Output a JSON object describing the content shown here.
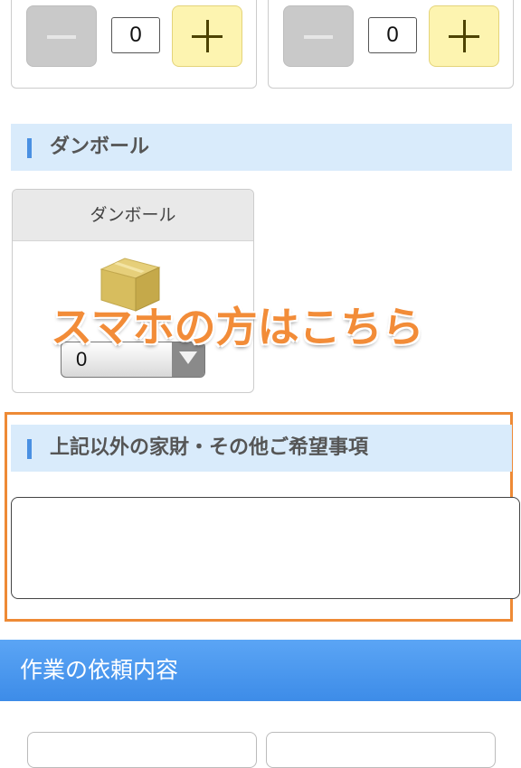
{
  "top_steppers": [
    {
      "value": "0"
    },
    {
      "value": "0"
    }
  ],
  "sections": {
    "cardboard": {
      "title": "ダンボール",
      "card_title": "ダンボール",
      "select_value": "0",
      "icon": "cardboard-box-icon"
    },
    "notes": {
      "title": "上記以外の家財・その他ご希望事項",
      "textarea_value": ""
    }
  },
  "overlay": {
    "text": "スマホの方はこちら",
    "color": "#f28c38"
  },
  "work_section": {
    "title": "作業の依頼内容"
  },
  "colors": {
    "header_bg": "#d9ebfb",
    "header_bar": "#4a90e2",
    "banner": "#4a98ef",
    "highlight_frame": "#ee8a35",
    "plus_button": "#fdf4b0",
    "minus_button": "#c9c9c9"
  }
}
